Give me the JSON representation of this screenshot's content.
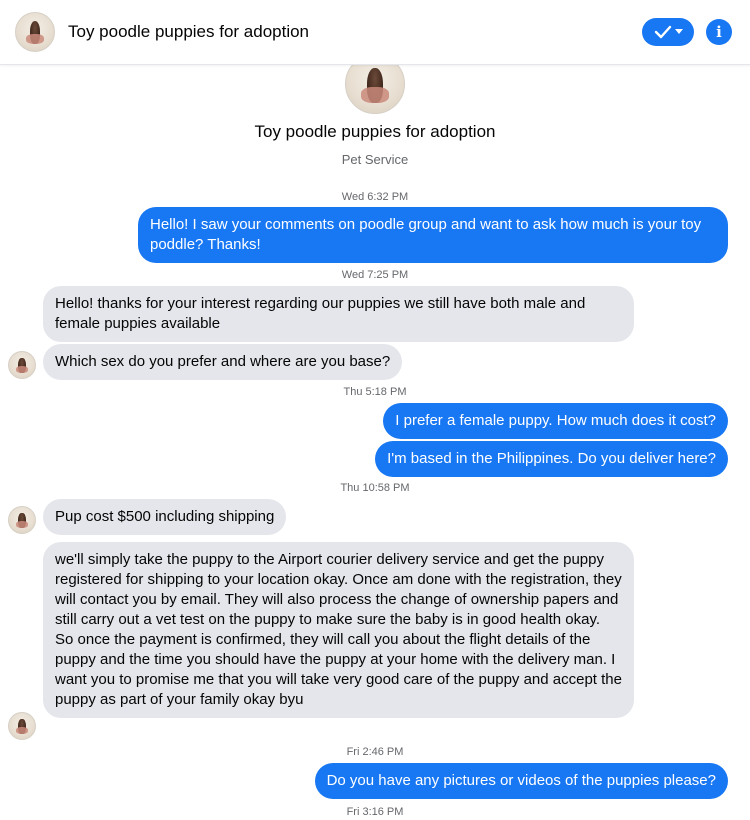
{
  "header": {
    "title": "Toy poodle puppies for adoption",
    "icons": {
      "avatar": "poodle-profile-photo",
      "check": "check-icon",
      "dropdown": "chevron-down-icon",
      "info": "info-icon"
    },
    "accent_color": "#1877f2"
  },
  "profile": {
    "name": "Toy poodle puppies for adoption",
    "category": "Pet Service"
  },
  "timestamps": [
    "Wed 6:32 PM",
    "Wed 7:25 PM",
    "Thu 5:18 PM",
    "Thu 10:58 PM",
    "Fri 2:46 PM",
    "Fri 3:16 PM"
  ],
  "messages": [
    {
      "from": "me",
      "text": "Hello! I saw your comments on poodle group and want to ask how much is your toy poddle? Thanks!"
    },
    {
      "from": "them",
      "text": "Hello! thanks for your interest regarding our puppies we still have both male and female puppies available"
    },
    {
      "from": "them",
      "text": "Which sex do you prefer and where are you base?"
    },
    {
      "from": "me",
      "text": "I prefer a female puppy. How much does it cost?"
    },
    {
      "from": "me",
      "text": "I'm based in the Philippines. Do you deliver here?"
    },
    {
      "from": "them",
      "text": "Pup cost $500 including shipping"
    },
    {
      "from": "them",
      "text": "we'll simply take the puppy to the Airport courier delivery service and get the puppy registered for shipping to your location okay. Once am done with the registration, they will contact you by email. They will also process the change of ownership papers and still carry out a vet test on the puppy to make sure the baby is in good health okay. So once the payment is confirmed, they will call you about the flight details of the puppy  and the time you should have the puppy at your home with the delivery man. I want you to promise me that you will take very good care of the puppy and accept the puppy as part of your family okay byu"
    },
    {
      "from": "me",
      "text": "Do you have any pictures or videos of the puppies please?"
    }
  ]
}
